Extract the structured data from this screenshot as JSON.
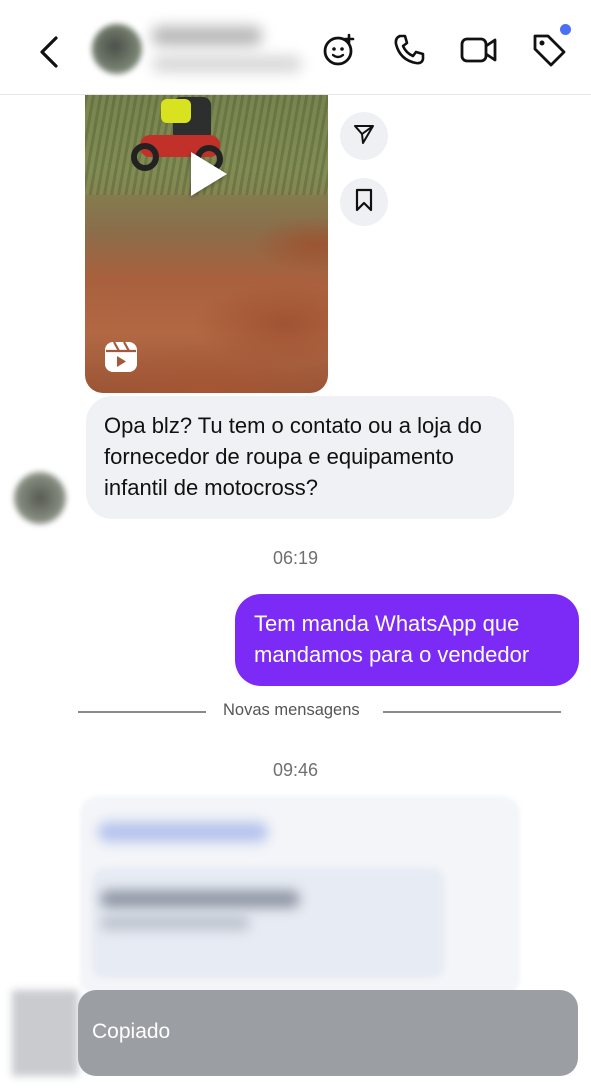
{
  "header": {
    "icons": [
      "back-icon",
      "sticker-icon",
      "phone-icon",
      "video-icon",
      "tag-icon"
    ],
    "accent_dot": "#4c6ef5"
  },
  "media": {
    "icons": [
      "play-icon",
      "reels-icon",
      "send-icon",
      "bookmark-icon"
    ]
  },
  "messages": {
    "received": "Opa blz? Tu tem o contato ou a loja do fornecedor de roupa e equipamento infantil de motocross?",
    "time1": "06:19",
    "sent": "Tem manda WhatsApp que mandamos para o vendedor",
    "divider": "Novas mensagens",
    "time2": "09:46"
  },
  "toast": {
    "text": "Copiado"
  },
  "colors": {
    "outgoing_bubble": "#7b2bf5",
    "incoming_bubble": "#eff1f4"
  }
}
